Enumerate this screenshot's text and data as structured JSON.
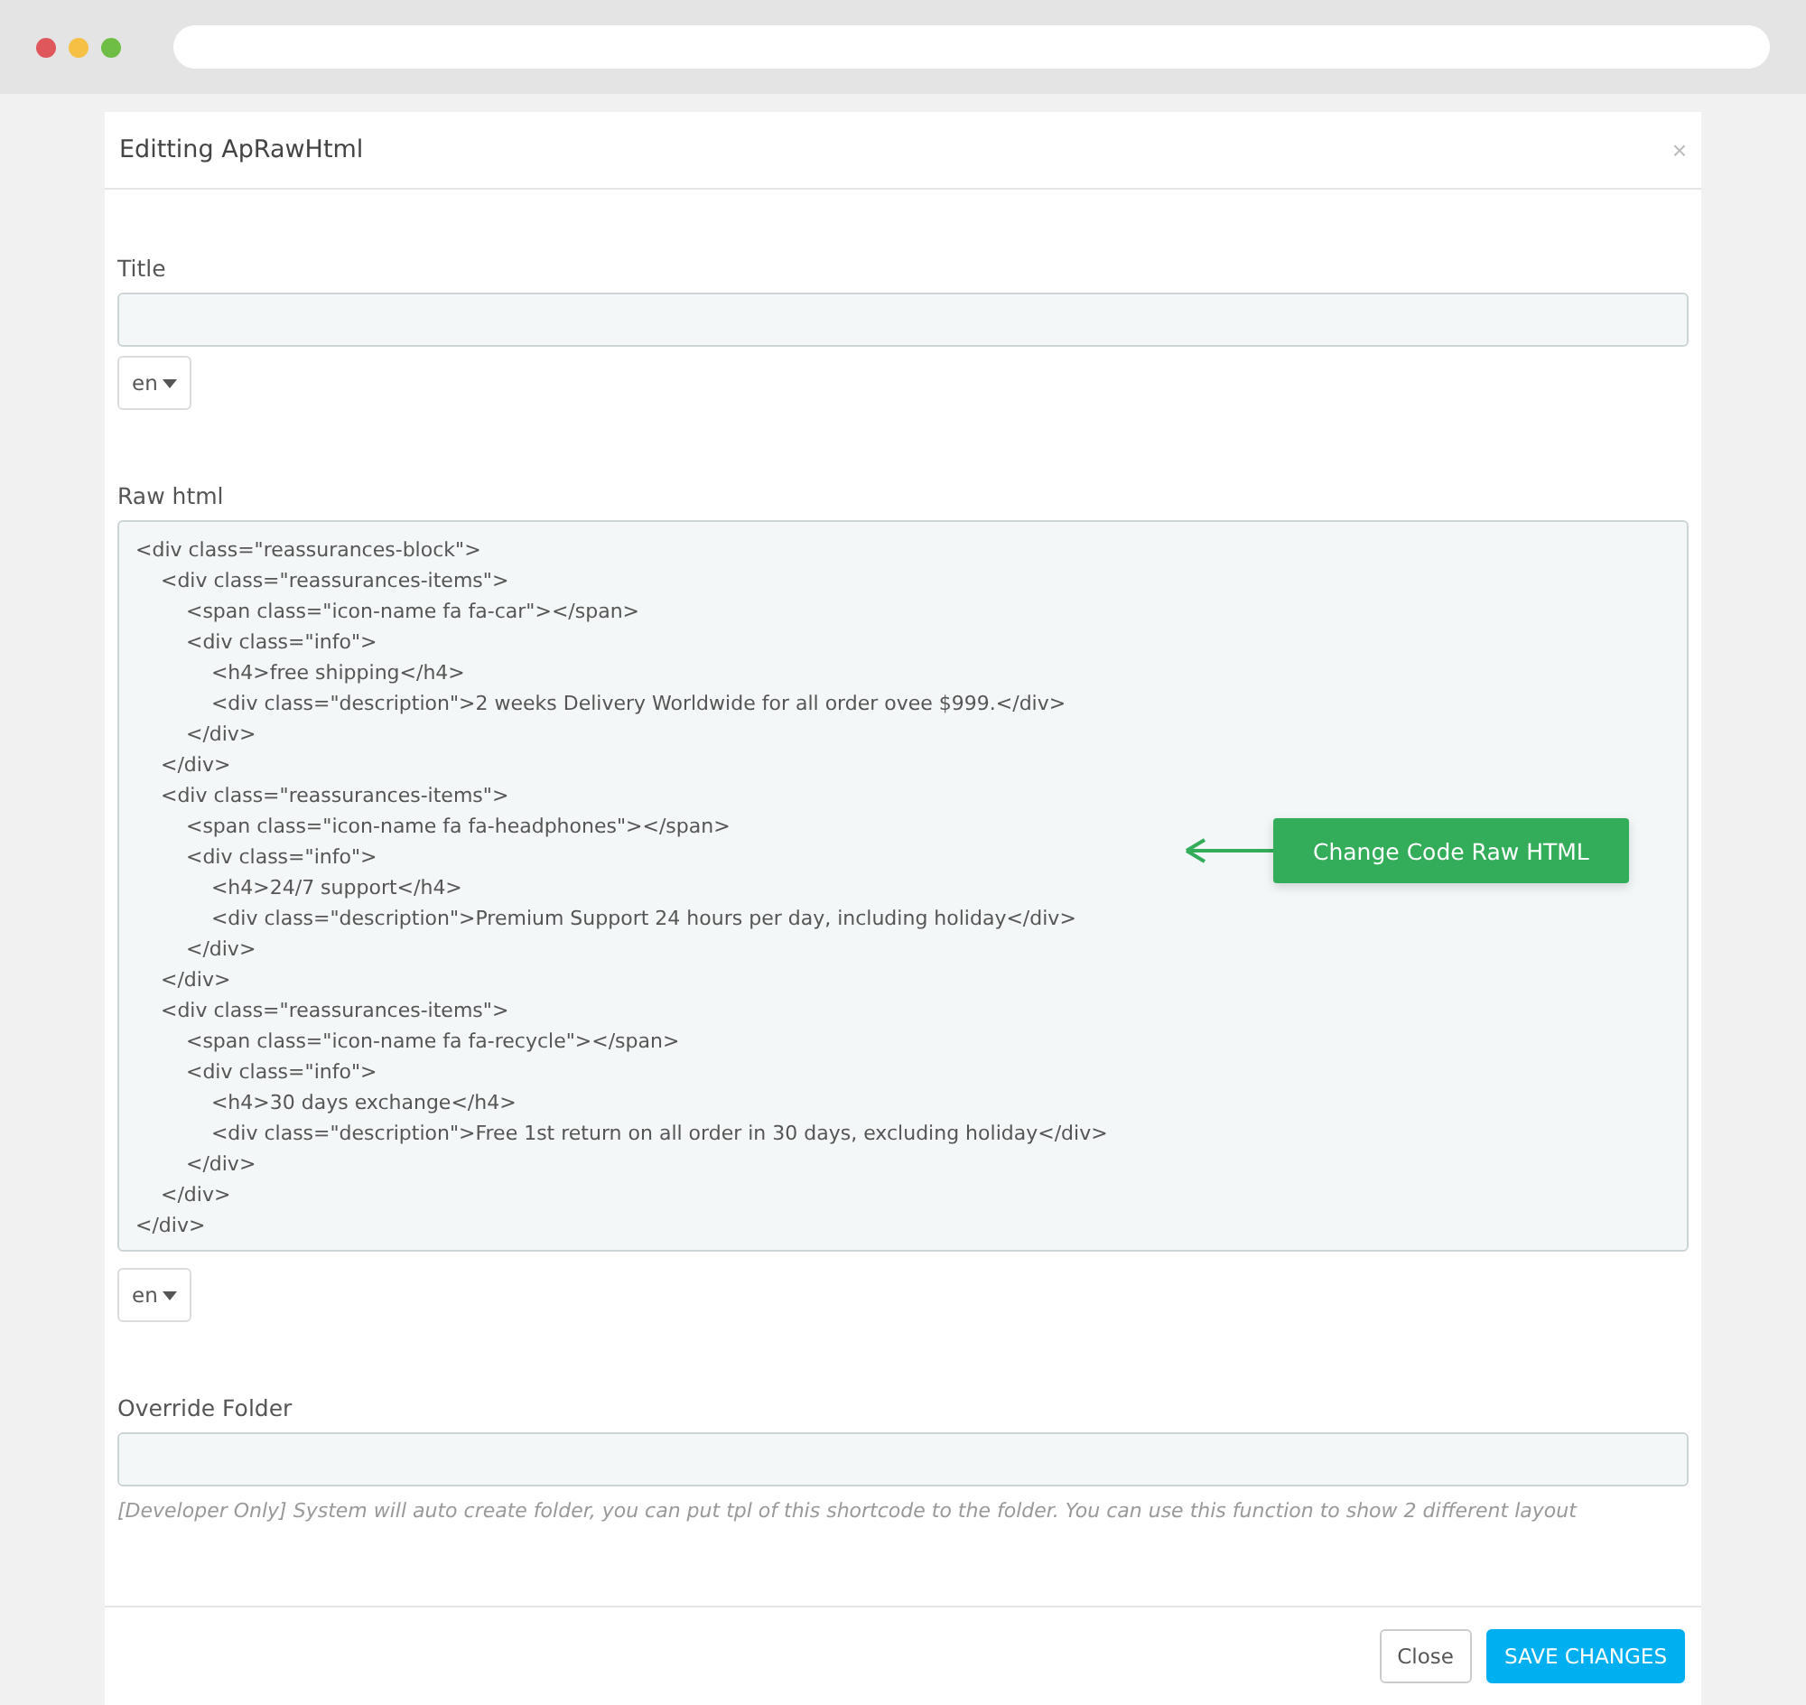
{
  "browser": {
    "dots": [
      {
        "color": "#e0575b"
      },
      {
        "color": "#f5c043"
      },
      {
        "color": "#6ebe45"
      }
    ]
  },
  "modal": {
    "title": "Editting ApRawHtml",
    "close": "×",
    "fields": [
      {
        "kind": "input",
        "label": "Title",
        "lang": "en"
      },
      {
        "kind": "code",
        "label": "Raw html",
        "value": "<div class=\"reassurances-block\">\n    <div class=\"reassurances-items\">\n        <span class=\"icon-name fa fa-car\"></span>\n        <div class=\"info\">\n            <h4>free shipping</h4>\n            <div class=\"description\">2 weeks Delivery Worldwide for all order ovee $999.</div>\n        </div>\n    </div>\n    <div class=\"reassurances-items\">\n        <span class=\"icon-name fa fa-headphones\"></span>\n        <div class=\"info\">\n            <h4>24/7 support</h4>\n            <div class=\"description\">Premium Support 24 hours per day, including holiday</div>\n        </div>\n    </div>\n    <div class=\"reassurances-items\">\n        <span class=\"icon-name fa fa-recycle\"></span>\n        <div class=\"info\">\n            <h4>30 days exchange</h4>\n            <div class=\"description\">Free 1st return on all order in 30 days, excluding holiday</div>\n        </div>\n    </div>\n</div>",
        "lang": "en",
        "callout": "Change Code Raw HTML"
      },
      {
        "kind": "input",
        "label": "Override Folder",
        "help": "[Developer Only] System will auto create folder, you can put tpl of this shortcode to the folder. You can use this function to show 2 different layout"
      }
    ],
    "buttons": [
      {
        "label": "Close",
        "kind": "default"
      },
      {
        "label": "SAVE CHANGES",
        "kind": "primary"
      }
    ]
  }
}
